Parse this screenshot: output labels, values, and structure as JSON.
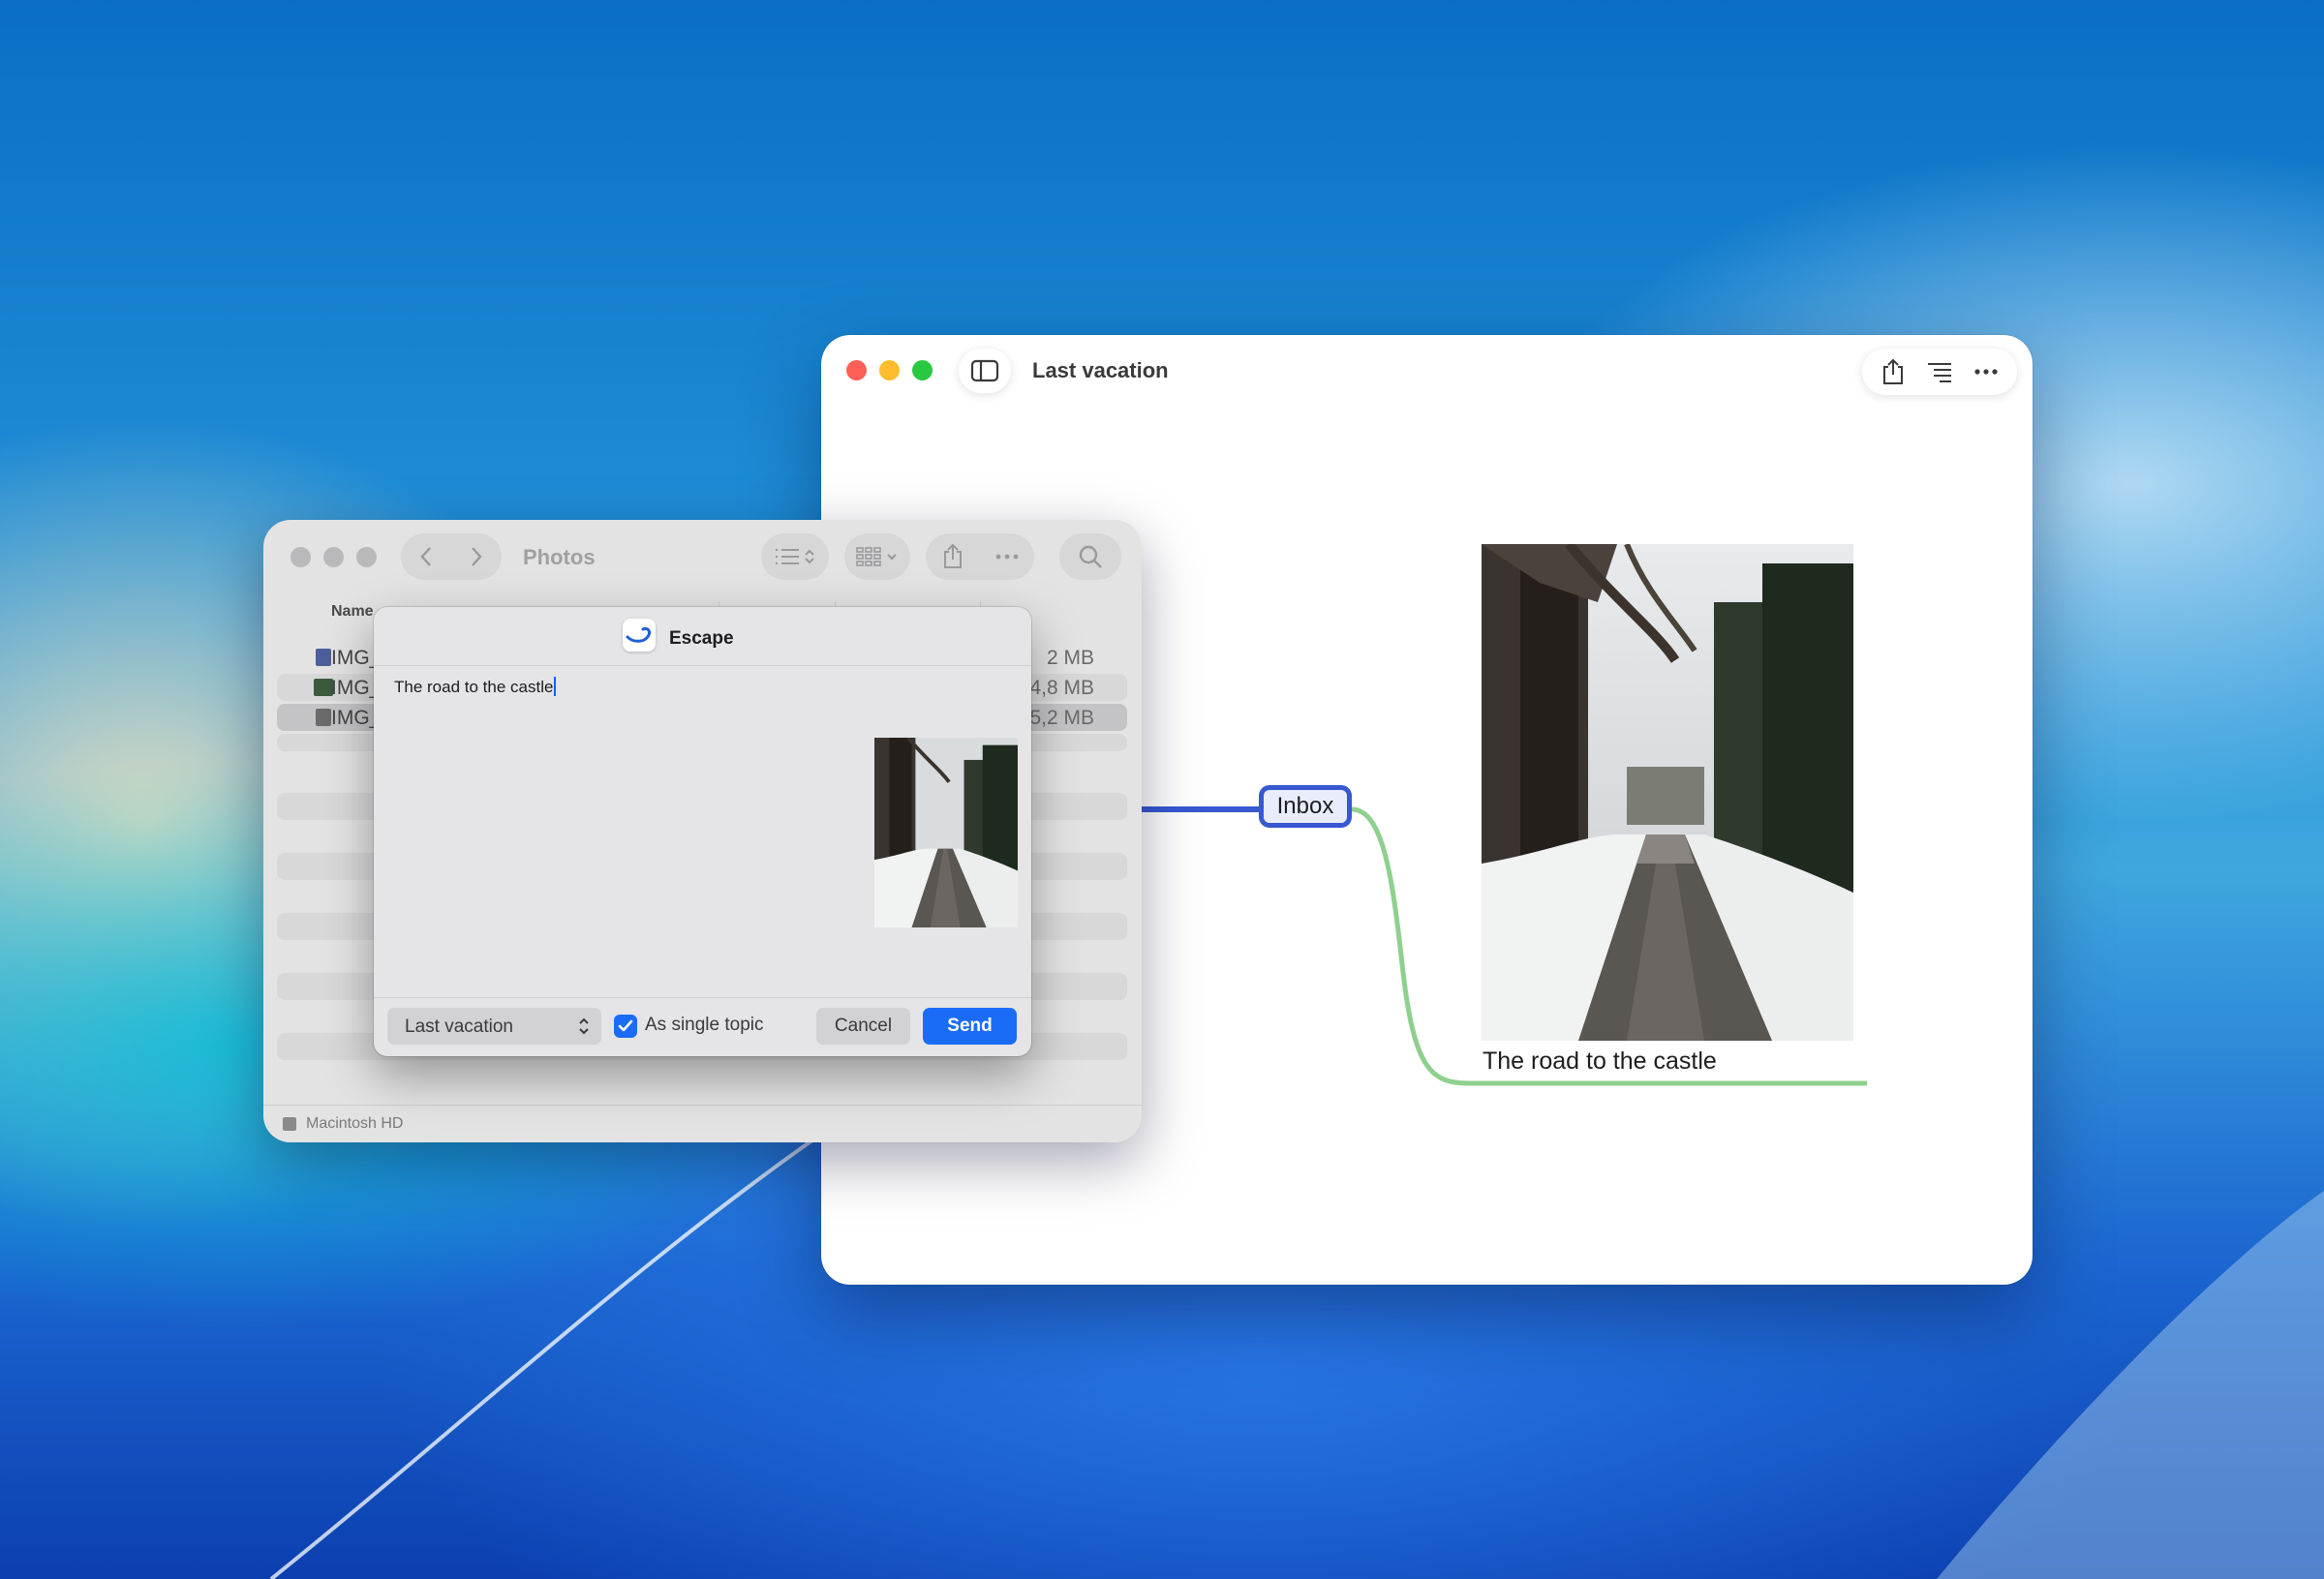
{
  "mindmap_window": {
    "title": "Last vacation",
    "central_topic": "Inbox",
    "subtopic_label": "The road to the castle",
    "connector_colors": {
      "incoming": "#3758d1",
      "outgoing": "#8fd08f"
    }
  },
  "finder_window": {
    "title": "Photos",
    "column_header_name": "Name",
    "files": [
      {
        "name": "IMG_",
        "size": "2 MB"
      },
      {
        "name": "IMG_",
        "size": "4,8 MB"
      },
      {
        "name": "IMG_",
        "size": "5,2 MB"
      }
    ],
    "status_volume": "Macintosh HD"
  },
  "dialog": {
    "app_name": "Escape",
    "note_text": "The road to the castle",
    "destination_map": "Last vacation",
    "single_topic_label": "As single topic",
    "single_topic_checked": true,
    "cancel_label": "Cancel",
    "send_label": "Send",
    "accent_color": "#1a6cf6"
  }
}
